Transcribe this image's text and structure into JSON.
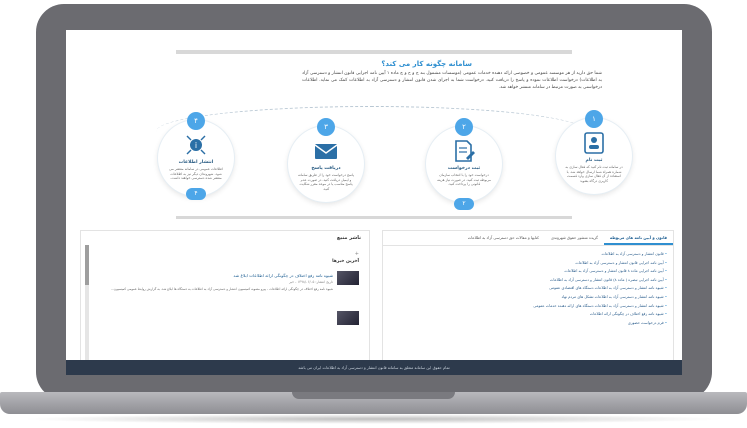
{
  "how": {
    "title": "سامانه چگونه کار می کند؟",
    "text": "شما حق دارید از هر موسسه عمومی و خصوصی ارائه دهنده خدمات عمومی (موسسات مشمول بند ج و ح و چ ماده ۱ آیین نامه اجرایی قانون انتشار و دسترسی آزاد به اطلاعات) درخواست اطلاعات نموده و پاسخ را دریافت کنید. درخواست شما به اجرای شدن قانون انتشار و دسترسی آزاد به اطلاعات کمک می نماید. اطلاعات درخواستی به صورت مرتبط در سامانه منتشر خواهد شد."
  },
  "steps": [
    {
      "num": "۱",
      "title": "ثبت نام",
      "desc": "در سامانه ثبت نام کنید که فعال سازی به شماره همراه شما ارسال خواهد شد. با استفاده از آن فعال سازی وارد قسمت کاربری درگاه بشوید",
      "icon": "user-card-icon"
    },
    {
      "num": "۲",
      "title": "ثبت درخواست",
      "desc": "درخواست خود را با انتخاب سازمان مربوطه ثبت کنید. در صورت نیاز هزینه قانونی را پرداخت کنید.",
      "icon": "document-edit-icon"
    },
    {
      "num": "۳",
      "title": "دریافت پاسخ",
      "desc": "پاسخ درخواست خود را از طریق سامانه و ایمیل دریافت کنید. در صورت عدم پاسخ مناسب یا در موعد مقرر شکایت کنید.",
      "icon": "envelope-icon"
    },
    {
      "num": "۴",
      "title": "انتشار اطلاعات",
      "desc": "اطلاعات عمومی در سامانه منتشر می شود. شهروندان دیگر نیز به اطلاعات منتشر شده دسترسی خواهند داشت.",
      "icon": "info-network-icon"
    }
  ],
  "tabs": [
    {
      "label": "قانون و آیین نامه های مربوطه",
      "active": true
    },
    {
      "label": "گزیده منشور حقوق شهروندی",
      "active": false
    },
    {
      "label": "کتابها و مقالات حق دسترسی آزاد به اطلاعات",
      "active": false
    }
  ],
  "links": [
    "قانون انتشار و دسترسی آزاد به اطلاعات",
    "آیین نامه اجرایی قانون انتشار و دسترسی آزاد به اطلاعات",
    "آیین نامه اجرایی ماده ۸ قانون انتشار و دسترسی آزاد به اطلاعات",
    "آیین نامه اجرایی تبصره ( ماده ۸) قانون انتشار و دسترسی آزاد به اطلاعات",
    "شیوه نامه انتشار و دسترسی آزاد به اطلاعات دستگاه های اقتصادی عمومی",
    "شیوه نامه انتشار و دسترسی آزاد به اطلاعات تشکل های مردم نهاد",
    "شیوه نامه انتشار و دسترسی آزاد به اطلاعات دستگاه های ارائه دهنده خدمات عمومی",
    "شیوه نامه رفع اختلاف در چگونگی ارائه اطلاعات",
    "فرم درخواست حضوری"
  ],
  "publisher": {
    "title": "ناشر منبع",
    "expand": "+",
    "latest": "آخرین خبرها",
    "news": [
      {
        "title": "شیوه نامه رفع اختلاف در چگونگی ارائه اطلاعات ابلاغ شد",
        "meta": "تاریخ انتشار: ۱۳۹۸/۰۶/۰۵ - خبر",
        "text": "شیوه نامه رفع اختلاف در چگونگی ارائه اطلاعات - پیرو مصوبه کمیسیون انتشار و دسترسی آزاد به اطلاعات به دستگاه ها ابلاغ شد. به گزارش روابط عمومی کمیسیون..."
      }
    ]
  },
  "footer": "تمام حقوق این سامانه متعلق به سامانه قانون انتشار و دسترسی آزاد به اطلاعات ایران می باشد"
}
